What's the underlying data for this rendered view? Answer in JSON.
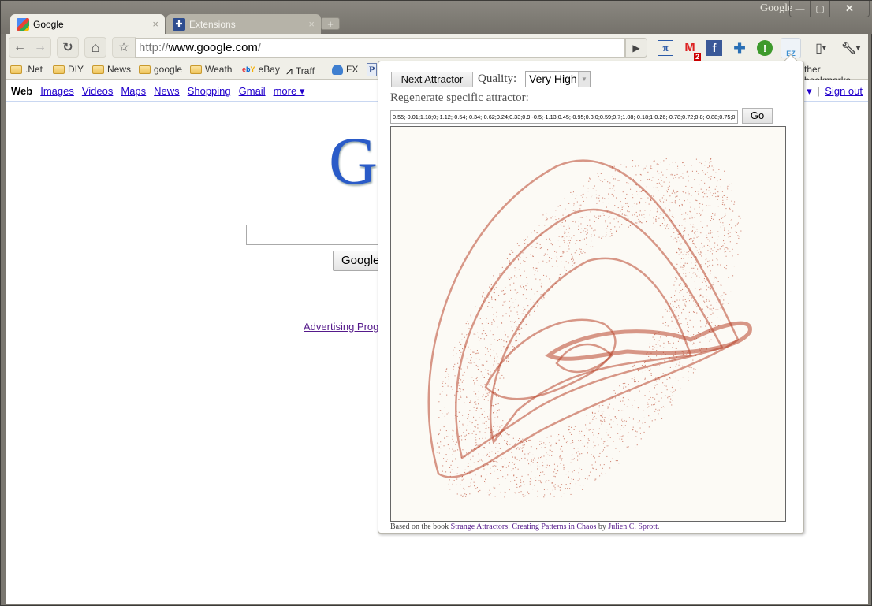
{
  "window": {
    "brand": "Google",
    "controls": {
      "minimize": "—",
      "maximize": "▢",
      "close": "✕"
    }
  },
  "tabs": [
    {
      "title": "Google",
      "icon": "google-favicon",
      "active": true,
      "close": "×"
    },
    {
      "title": "Extensions",
      "icon": "puzzle-icon",
      "active": false,
      "close": "×"
    }
  ],
  "new_tab_label": "+",
  "toolbar": {
    "back": "←",
    "forward": "→",
    "reload": "↻",
    "home": "⌂",
    "star": "☆",
    "url_scheme": "http://",
    "url_host": "www.google.com",
    "url_path": "/",
    "go": "▶",
    "extensions": [
      {
        "name": "pi-icon",
        "glyph": "π",
        "color": "#2b5aa8"
      },
      {
        "name": "gmail-checker-icon",
        "glyph": "M",
        "color": "#d22",
        "badge": "2"
      },
      {
        "name": "facebook-icon",
        "glyph": "f",
        "color": "#3b5998"
      },
      {
        "name": "puzzle-extension-icon",
        "glyph": "✚",
        "color": "#2a6fb5"
      },
      {
        "name": "alert-icon",
        "glyph": "!",
        "color": "#fff",
        "bg": "#3e9a2c"
      },
      {
        "name": "attractor-ez-icon",
        "glyph": "EZ",
        "color": "#3a8fd1"
      }
    ],
    "page_menu": "▾",
    "wrench_menu": "▾"
  },
  "bookmarks": [
    {
      "label": ".Net",
      "icon": "folder-icon"
    },
    {
      "label": "DIY",
      "icon": "folder-icon"
    },
    {
      "label": "News",
      "icon": "folder-icon"
    },
    {
      "label": "google",
      "icon": "folder-icon"
    },
    {
      "label": "Weath",
      "icon": "folder-icon"
    },
    {
      "label": "eBay",
      "icon": "ebay-icon"
    },
    {
      "label": "Traff",
      "icon": "traffic-icon"
    },
    {
      "label": "FX",
      "icon": "fx-icon"
    },
    {
      "label": "P",
      "icon": "p-icon"
    }
  ],
  "other_bookmarks": "ther bookmarks",
  "google_page": {
    "nav": [
      {
        "label": "Web",
        "current": true
      },
      {
        "label": "Images"
      },
      {
        "label": "Videos"
      },
      {
        "label": "Maps"
      },
      {
        "label": "News"
      },
      {
        "label": "Shopping"
      },
      {
        "label": "Gmail"
      },
      {
        "label": "more ▾"
      }
    ],
    "right_nav": {
      "arrow": "▾",
      "separator": "|",
      "sign_out": "Sign out"
    },
    "logo": "G",
    "search_value": "",
    "search_button": "Google",
    "advertising_link": "Advertising Prog"
  },
  "popup": {
    "next_button": "Next Attractor",
    "quality_label": "Quality:",
    "quality_value": "Very High",
    "regenerate_label": "Regenerate specific attractor:",
    "params_value": "0.55;-0.01;1.18;0;-1.12;-0.54;-0.34;-0.62;0.24;0.33;0.9;-0.5;-1.13;0.45;-0.95;0.3;0;0.59;0.7;1.08;-0.18;1;0.26;-0.78;0.72;0.8;-0.88;0.75;0",
    "go_button": "Go",
    "credit_prefix": "Based on the book ",
    "credit_book": "Strange Attractors: Creating Patterns in Chaos",
    "credit_by": " by ",
    "credit_author": "Julien C. Sprott",
    "credit_suffix": ".",
    "attractor_color": "#b8442a",
    "canvas_bg": "#fcfaf5"
  }
}
